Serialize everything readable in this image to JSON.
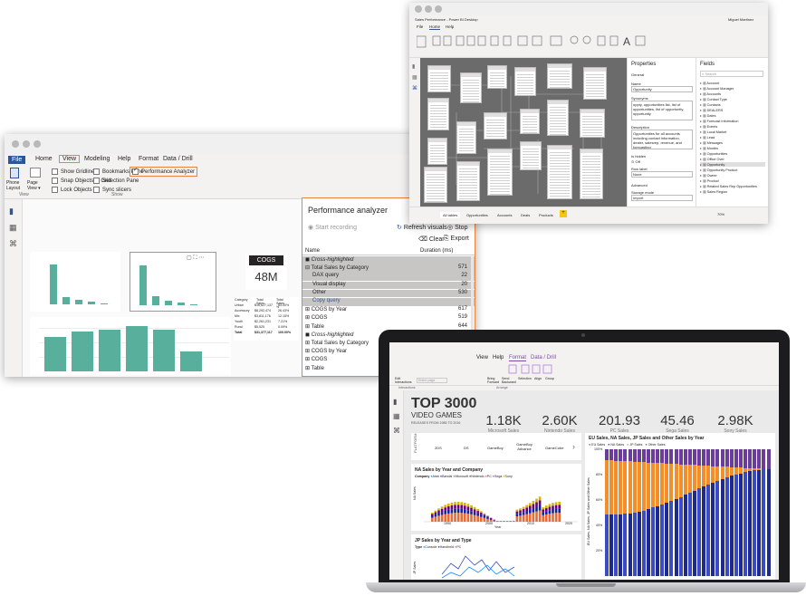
{
  "window1": {
    "tabs": [
      "File",
      "Home",
      "View",
      "Modeling",
      "Help",
      "Format",
      "Data / Drill"
    ],
    "ribbon": {
      "phone_layout": "Phone Layout",
      "page_view": "Page View ▾",
      "view_group": "View",
      "show_group": "Show",
      "checkboxes": [
        "Show Gridlines",
        "Snap Objects to Grid",
        "Lock Objects",
        "Bookmarks Pane",
        "Selection Pane",
        "Sync slicers",
        "Performance Analyzer"
      ]
    },
    "visuals": {
      "cogs_title": "COGS",
      "cogs_value": "48M",
      "table_headers": [
        "Category",
        "Total Sales",
        "Total Sales %"
      ],
      "table_rows": [
        [
          "Urban",
          "$16,627,137",
          "53.00%"
        ],
        [
          "Accessory",
          "$8,292,474",
          "26.43%"
        ],
        [
          "Mix",
          "$3,811,176",
          "12.15%"
        ],
        [
          "Youth",
          "$2,261,231",
          "7.21%"
        ],
        [
          "Rural",
          "$5,525",
          "0.09%"
        ],
        [
          "Total",
          "$31,377,117",
          "100.00%"
        ]
      ]
    },
    "perf": {
      "title": "Performance analyzer",
      "start": "Start recording",
      "refresh": "Refresh visuals",
      "stop": "Stop",
      "clear": "Clear",
      "export": "Export",
      "col_name": "Name",
      "col_duration": "Duration (ms)",
      "rows": [
        {
          "name": "Cross-highlighted",
          "dur": "",
          "sel": true,
          "indent": 0,
          "kind": "section"
        },
        {
          "name": "Total Sales by Category",
          "dur": "571",
          "sel": true,
          "indent": 0,
          "kind": "minus"
        },
        {
          "name": "DAX query",
          "dur": "22",
          "sel": true,
          "indent": 1,
          "kind": "plain"
        },
        {
          "name": "Visual display",
          "dur": "20",
          "sel": true,
          "indent": 1,
          "kind": "plain"
        },
        {
          "name": "Other",
          "dur": "530",
          "sel": true,
          "indent": 1,
          "kind": "plain"
        },
        {
          "name": "Copy query",
          "dur": "",
          "sel": true,
          "indent": 1,
          "kind": "link"
        },
        {
          "name": "COGS by Year",
          "dur": "617",
          "sel": false,
          "indent": 0,
          "kind": "plus"
        },
        {
          "name": "COGS",
          "dur": "519",
          "sel": false,
          "indent": 0,
          "kind": "plus"
        },
        {
          "name": "Table",
          "dur": "644",
          "sel": false,
          "indent": 0,
          "kind": "plus"
        },
        {
          "name": "Cross-highlighted",
          "dur": "",
          "sel": false,
          "indent": 0,
          "kind": "section"
        },
        {
          "name": "Total Sales by Category",
          "dur": "257",
          "sel": false,
          "indent": 0,
          "kind": "plus"
        },
        {
          "name": "COGS by Year",
          "dur": "324",
          "sel": false,
          "indent": 0,
          "kind": "plus"
        },
        {
          "name": "COGS",
          "dur": "271",
          "sel": false,
          "indent": 0,
          "kind": "plus"
        },
        {
          "name": "Table",
          "dur": "453",
          "sel": false,
          "indent": 0,
          "kind": "plus"
        }
      ]
    }
  },
  "window2": {
    "title": "Sales Performance - Power BI Desktop",
    "user": "Miguel Martinez",
    "tabs": [
      "File",
      "Home",
      "Help"
    ],
    "properties": {
      "title": "Properties",
      "general": "General",
      "name_label": "Name",
      "name_value": "Opportunity",
      "synonyms_label": "Synonyms",
      "synonyms_value": "oppty, opportunities list, list of opportunities, list of opportunity, opportunity",
      "description_label": "Description",
      "description_value": "Opportunities for all accounts including contact information, dealer, salesrep, revenue, and forecasting",
      "hidden_label": "Is hidden",
      "hidden_value": "Off",
      "rowlabel": "Row label",
      "rowlabel_value": "None",
      "advanced": "Advanced",
      "storage_label": "Storage mode",
      "storage_value": "Import"
    },
    "fields": {
      "title": "Fields",
      "search": "Search",
      "items": [
        "Account",
        "Account Manager",
        "Accounts",
        "Contact Type",
        "Contacts",
        "DEALERS",
        "Dates",
        "Forecast Information",
        "Events",
        "Local Market",
        "Lead",
        "Messages",
        "Months",
        "Opportunities",
        "Office Over",
        "Opportunity",
        "Opportunity Product",
        "Owner",
        "Product",
        "Related Sales Rep Opportunities",
        "Sales Region"
      ]
    },
    "bottom_tabs": [
      "All tables",
      "Opportunities",
      "Accounts",
      "Deals",
      "Products"
    ],
    "zoom": "70%"
  },
  "laptop": {
    "tabs": [
      "View",
      "Help",
      "Format",
      "Data / Drill"
    ],
    "ribbon": [
      "Edit Interactions",
      "Entire page",
      "Bring Forward",
      "Send Backward",
      "Selection",
      "Align",
      "Group"
    ],
    "section_labels": [
      "Interactions",
      "Arrange"
    ],
    "header": {
      "title": "TOP 3000",
      "subtitle": "VIDEO GAMES",
      "note": "RELEASES FROM 1985 TO 2016"
    },
    "kpis": [
      {
        "value": "1.18K",
        "label": "Microsoft Sales"
      },
      {
        "value": "2.60K",
        "label": "Nintendo Sales"
      },
      {
        "value": "201.93",
        "label": "PC Sales"
      },
      {
        "value": "45.46",
        "label": "Sega Sales"
      },
      {
        "value": "2.98K",
        "label": "Sony Sales"
      }
    ],
    "platform_label": "PLATFORM",
    "platforms": [
      "2DS",
      "DS",
      "GameBoy",
      "GameBoy Advance",
      "GameCube"
    ],
    "chart1": {
      "title": "NA Sales by Year and Company",
      "legend_label": "Company",
      "legend": [
        "Atari",
        "Bandai",
        "Microsoft",
        "Nintendo",
        "PC",
        "Sega",
        "Sony"
      ],
      "xlabel": "Year",
      "ylabel": "NA Sales",
      "xticks": [
        "1990",
        "2000",
        "2010",
        "2020"
      ]
    },
    "chart2": {
      "title": "JP Sales by Year and Type",
      "legend_label": "Type",
      "legend": [
        "Console",
        "Handheld",
        "PC"
      ],
      "ylabel": "JP Sales"
    },
    "chart3": {
      "title": "EU Sales, NA Sales, JP Sales and Other Sales by Year",
      "legend": [
        "EU Sales",
        "NA Sales",
        "JP Sales",
        "Other Sales"
      ],
      "ylabel": "EU Sales, NA Sales, JP Sales and Other Sales",
      "yticks": [
        "100%",
        "80%",
        "60%",
        "40%",
        "20%"
      ]
    }
  }
}
